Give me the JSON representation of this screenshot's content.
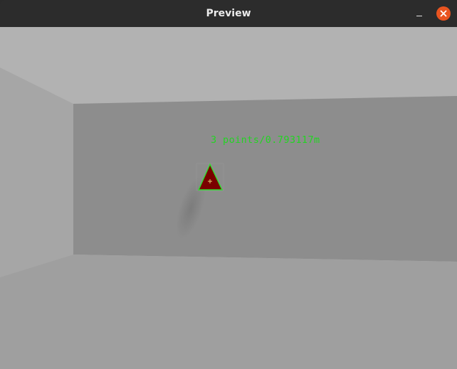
{
  "window": {
    "title": "Preview",
    "close_label": "×"
  },
  "scene": {
    "measurement_label": "3 points/0.793117m",
    "marker": "triangle-marker",
    "colors": {
      "ceiling": "#b1b1b1",
      "back_wall": "#8c8c8c",
      "left_wall": "#a5a5a5",
      "floor": "#9e9e9e",
      "label": "#22d522",
      "marker_fill": "#7a0000",
      "marker_outline": "#2fe02f"
    }
  }
}
